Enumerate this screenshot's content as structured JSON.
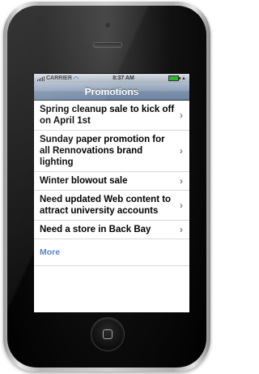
{
  "status_bar": {
    "carrier": "CARRIER",
    "time": "8:37 AM",
    "battery_color": "#2bb52b"
  },
  "nav": {
    "title": "Promotions"
  },
  "items": [
    {
      "label": "Spring cleanup sale to kick off on April 1st"
    },
    {
      "label": "Sunday paper promotion for all Rennovations brand lighting"
    },
    {
      "label": "Winter blowout sale"
    },
    {
      "label": "Need updated Web content to attract university accounts"
    },
    {
      "label": "Need a store in Back Bay"
    }
  ],
  "more_label": "More",
  "icons": {
    "chevron": "chevron-right-icon",
    "wifi": "wifi-icon",
    "signal": "signal-icon",
    "battery": "battery-icon",
    "home": "home-button"
  },
  "colors": {
    "nav_bar": "#6d84a2",
    "more_link": "#5b84c4"
  }
}
